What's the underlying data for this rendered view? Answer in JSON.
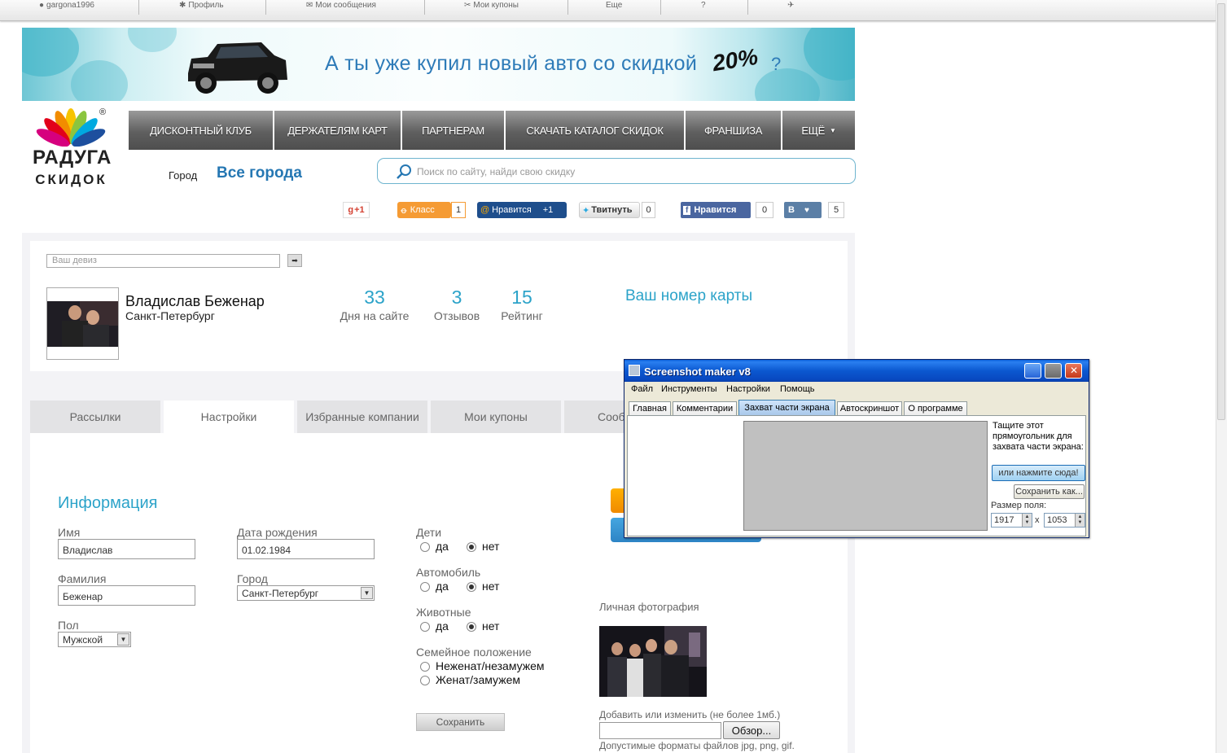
{
  "topbar": {
    "username": "gargona1996",
    "profile": "Профиль",
    "messages": "Мои сообщения",
    "coupons": "Мои купоны",
    "more": "Еще",
    "help_icon": "question-icon",
    "exit_icon": "runner-icon"
  },
  "banner": {
    "text": "А ты уже купил новый авто со скидкой",
    "percent": "20%",
    "q": "?"
  },
  "logo": {
    "line1": "РАДУГА",
    "line2": "СКИДОК",
    "reg": "®"
  },
  "nav": [
    "ДИСКОНТНЫЙ КЛУБ",
    "ДЕРЖАТЕЛЯМ КАРТ",
    "ПАРТНЕРАМ",
    "СКАЧАТЬ КАТАЛОГ СКИДОК",
    "ФРАНШИЗА",
    "ЕЩЁ"
  ],
  "city": {
    "label": "Город",
    "value": "Все города"
  },
  "search": {
    "placeholder": "Поиск по сайту, найди свою скидку"
  },
  "social": {
    "gplus": "+1",
    "ok": "Класс",
    "ok_count": "1",
    "mail": "Нравится",
    "mail_count": "+1",
    "tw": "Твитнуть",
    "tw_count": "0",
    "fb": "Нравится",
    "fb_count": "0",
    "vk": "В",
    "vk_count": "5"
  },
  "profile": {
    "motto_placeholder": "Ваш девиз",
    "name": "Владислав Беженар",
    "city": "Санкт-Петербург",
    "stats": [
      {
        "value": "33",
        "label": "Дня на сайте"
      },
      {
        "value": "3",
        "label": "Отзывов"
      },
      {
        "value": "15",
        "label": "Рейтинг"
      }
    ],
    "card": "Ваш номер карты"
  },
  "tabs": [
    "Рассылки",
    "Настройки",
    "Избранные компании",
    "Мои купоны",
    "Сооб"
  ],
  "form": {
    "title": "Информация",
    "first_label": "Имя",
    "first_value": "Владислав",
    "last_label": "Фамилия",
    "last_value": "Беженар",
    "gender_label": "Пол",
    "gender_value": "Мужской",
    "birth_label": "Дата рождения",
    "birth_value": "01.02.1984",
    "city_label": "Город",
    "city_value": "Санкт-Петербург",
    "kids_label": "Дети",
    "car_label": "Автомобиль",
    "pets_label": "Животные",
    "yes": "да",
    "no": "нет",
    "family_label": "Семейное положение",
    "single": "Неженат/незамужем",
    "married": "Женат/замужем",
    "save": "Сохранить",
    "photo_label": "Личная фотография",
    "add_label": "Добавить или изменить (не более 1мб.)",
    "browse": "Обзор...",
    "formats": "Допустимые форматы файлов jpg, png, gif."
  },
  "window": {
    "title": "Screenshot maker v8",
    "menus": [
      "Файл",
      "Инструменты",
      "Настройки",
      "Помощь"
    ],
    "tabs": [
      "Главная",
      "Комментарии",
      "Захват части экрана",
      "Автоскриншот",
      "О программе"
    ],
    "hint": "Тащите этот прямоугольник для захвата части экрана:",
    "click": "или нажмите сюда!",
    "saveas": "Сохранить как...",
    "size_label": "Размер поля:",
    "w": "1917",
    "h": "1053",
    "x": "x"
  }
}
